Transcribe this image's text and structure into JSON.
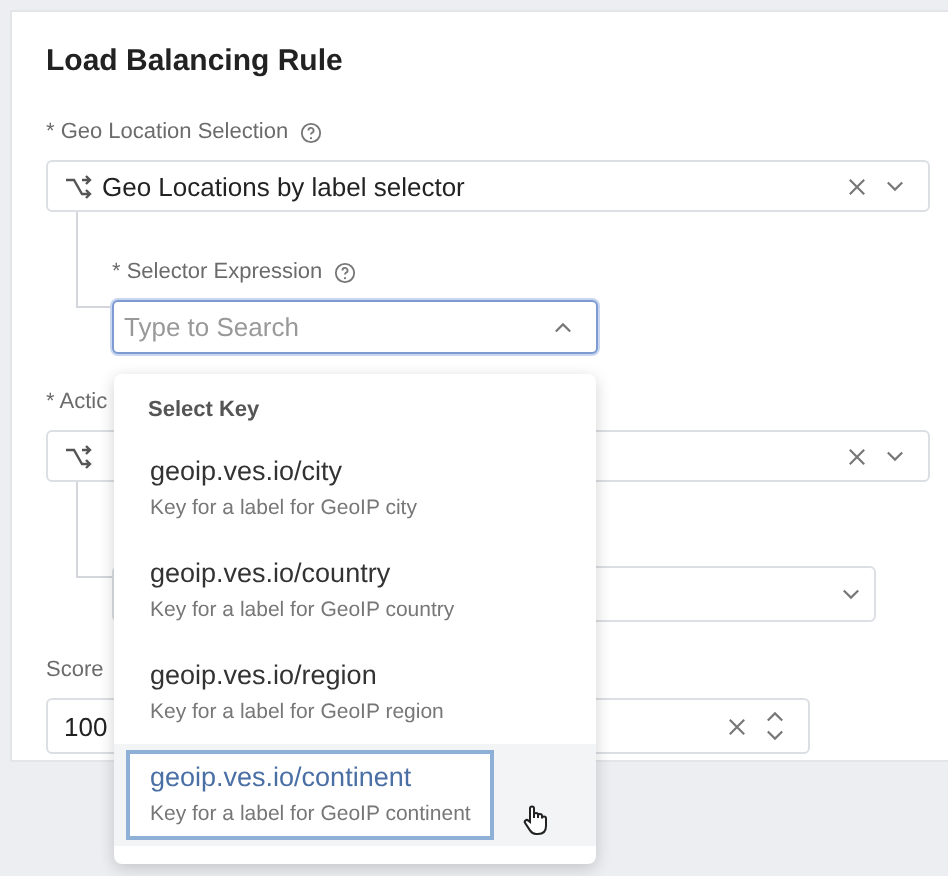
{
  "title": "Load Balancing Rule",
  "geo_location_selection": {
    "label": "* Geo Location Selection",
    "value": "Geo Locations by label selector",
    "selector_expression": {
      "label": "* Selector Expression",
      "placeholder": "Type to Search",
      "expanded": true
    }
  },
  "action": {
    "label": "* Actic",
    "sub_select": {
      "expanded": false
    }
  },
  "score": {
    "label": "Score",
    "value": "100"
  },
  "dropdown": {
    "header": "Select Key",
    "items": [
      {
        "key": "geoip.ves.io/city",
        "description": "Key for a label for GeoIP city",
        "selected": false
      },
      {
        "key": "geoip.ves.io/country",
        "description": "Key for a label for GeoIP country",
        "selected": false
      },
      {
        "key": "geoip.ves.io/region",
        "description": "Key for a label for GeoIP region",
        "selected": false
      },
      {
        "key": "geoip.ves.io/continent",
        "description": "Key for a label for GeoIP continent",
        "selected": true
      }
    ]
  }
}
